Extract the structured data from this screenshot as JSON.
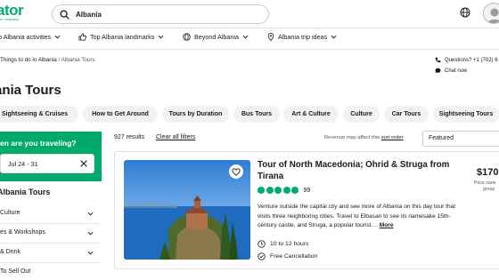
{
  "header": {
    "logo_text": "ator",
    "logo_sub": "er company",
    "search_value": "Albania",
    "brand_color": "#00aa6c"
  },
  "nav": {
    "items": [
      {
        "label": "o Albania activities",
        "icon": "chevron-down-icon"
      },
      {
        "label": "Top Albania landmarks",
        "icon": "thumbs-up-icon"
      },
      {
        "label": "Beyond Albania",
        "icon": "globe-icon"
      },
      {
        "label": "Albania trip ideas",
        "icon": "map-pin-icon"
      }
    ]
  },
  "breadcrumb": {
    "current_parent": "Things to do in Albania",
    "separator": " / ",
    "current": "Albania Tours"
  },
  "help": {
    "questions": "Questions? +1 (702) 6",
    "chat": "Chat now"
  },
  "page_title": "ania Tours",
  "chips": [
    "Sightseeing & Cruises",
    "How to Get Around",
    "Tours by Duration",
    "Bus Tours",
    "Art & Culture",
    "Culture",
    "Car Tours",
    "Sightseeing Tours"
  ],
  "sidebar": {
    "travel_question": "en are you traveling?",
    "dates": "Jul 24 - 31",
    "section_title": "Albania Tours",
    "items": [
      "Culture",
      "es & Workshops",
      "& Drink",
      "To Sell Out"
    ]
  },
  "results": {
    "count": "927 results",
    "clear": "Clear all filters",
    "revenue_note": "Revenue may affect this",
    "sort_order_link": "sort order",
    "sort_value": "Featured"
  },
  "card": {
    "title": "Tour of North Macedonia; Ohrid & Struga from Tirana",
    "rating_dots": 5,
    "review_count": "99",
    "description": "Venture outside the capital city and see more of Albania on this day tour that visits three neighboring cities. Travel to Elbasan to see its namesake 15th-century castle, and Struga, a popular tourist....",
    "more": "More",
    "duration": "10 to 12 hours",
    "cancellation": "Free Cancellation",
    "price": "$170.",
    "price_note_1": "Price varie",
    "price_note_2": "group"
  }
}
